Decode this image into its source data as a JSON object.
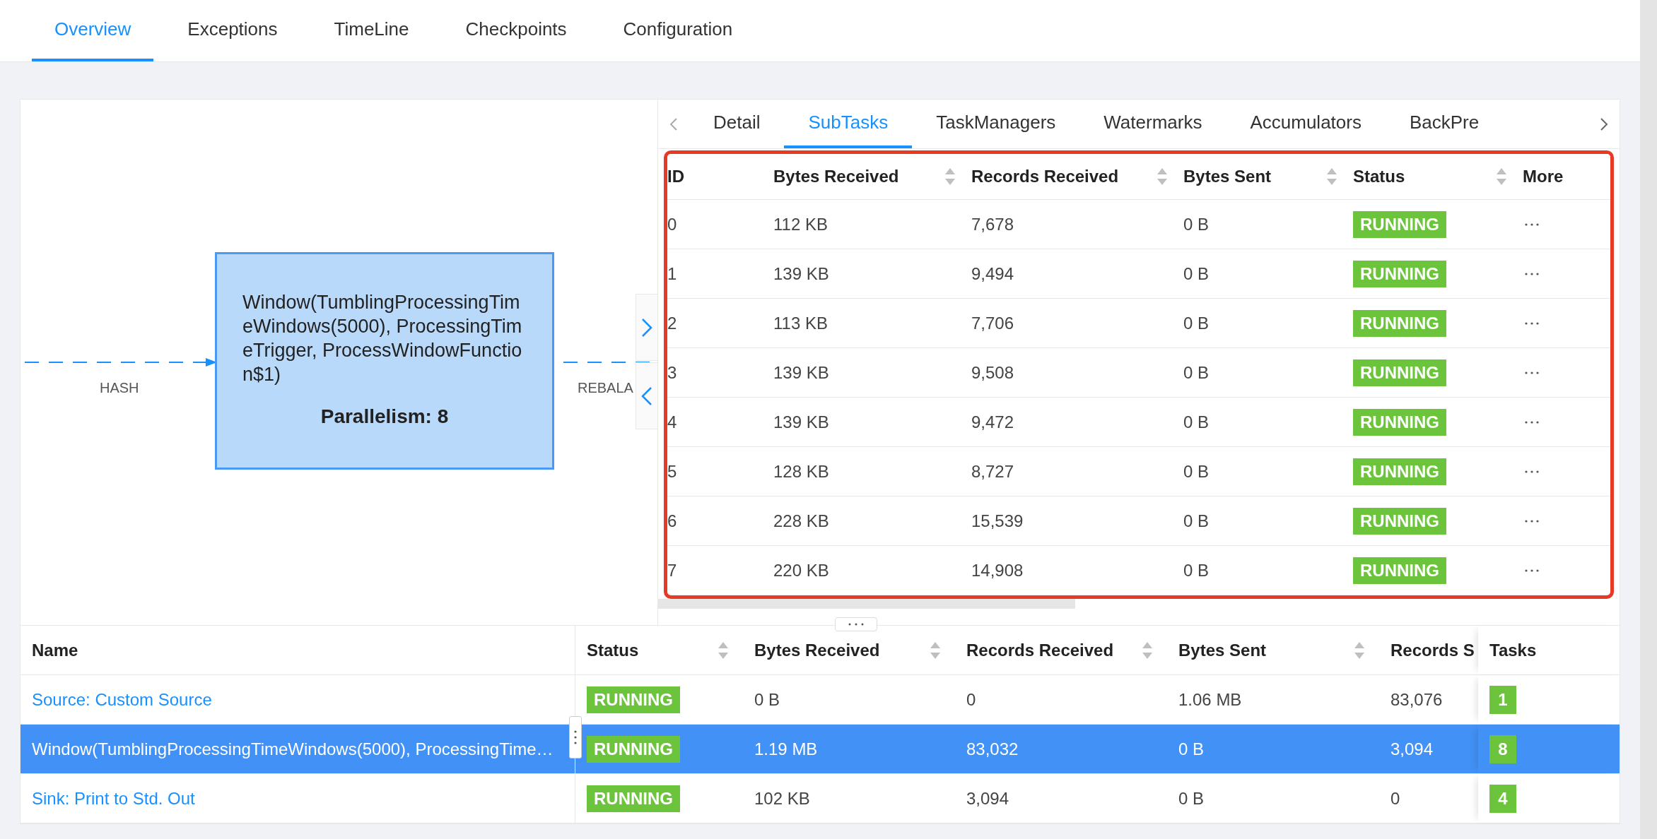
{
  "top_tabs": [
    {
      "label": "Overview",
      "selected": true
    },
    {
      "label": "Exceptions",
      "selected": false
    },
    {
      "label": "TimeLine",
      "selected": false
    },
    {
      "label": "Checkpoints",
      "selected": false
    },
    {
      "label": "Configuration",
      "selected": false
    }
  ],
  "graph": {
    "node": {
      "label": "Window(TumblingProcessingTimeWindows(5000), ProcessingTimeTrigger, ProcessWindowFunction$1)",
      "parallelism": "Parallelism: 8"
    },
    "edges": [
      {
        "label": "HASH"
      },
      {
        "label": "REBALA"
      }
    ]
  },
  "detail_tabs": [
    {
      "label": "Detail",
      "selected": false
    },
    {
      "label": "SubTasks",
      "selected": true
    },
    {
      "label": "TaskManagers",
      "selected": false
    },
    {
      "label": "Watermarks",
      "selected": false
    },
    {
      "label": "Accumulators",
      "selected": false
    },
    {
      "label": "BackPre",
      "selected": false
    }
  ],
  "subtasks": {
    "columns": [
      {
        "label": "ID",
        "sortable": false
      },
      {
        "label": "Bytes Received",
        "sortable": true
      },
      {
        "label": "Records Received",
        "sortable": true
      },
      {
        "label": "Bytes Sent",
        "sortable": true
      },
      {
        "label": "Status",
        "sortable": true
      },
      {
        "label": "More",
        "sortable": false
      }
    ],
    "rows": [
      {
        "id": "0",
        "bytes_received": "112 KB",
        "records_received": "7,678",
        "bytes_sent": "0 B",
        "status": "RUNNING"
      },
      {
        "id": "1",
        "bytes_received": "139 KB",
        "records_received": "9,494",
        "bytes_sent": "0 B",
        "status": "RUNNING"
      },
      {
        "id": "2",
        "bytes_received": "113 KB",
        "records_received": "7,706",
        "bytes_sent": "0 B",
        "status": "RUNNING"
      },
      {
        "id": "3",
        "bytes_received": "139 KB",
        "records_received": "9,508",
        "bytes_sent": "0 B",
        "status": "RUNNING"
      },
      {
        "id": "4",
        "bytes_received": "139 KB",
        "records_received": "9,472",
        "bytes_sent": "0 B",
        "status": "RUNNING"
      },
      {
        "id": "5",
        "bytes_received": "128 KB",
        "records_received": "8,727",
        "bytes_sent": "0 B",
        "status": "RUNNING"
      },
      {
        "id": "6",
        "bytes_received": "228 KB",
        "records_received": "15,539",
        "bytes_sent": "0 B",
        "status": "RUNNING"
      },
      {
        "id": "7",
        "bytes_received": "220 KB",
        "records_received": "14,908",
        "bytes_sent": "0 B",
        "status": "RUNNING"
      }
    ]
  },
  "vertices": {
    "columns": [
      {
        "label": "Name",
        "sortable": false
      },
      {
        "label": "Status",
        "sortable": true
      },
      {
        "label": "Bytes Received",
        "sortable": true
      },
      {
        "label": "Records Received",
        "sortable": true
      },
      {
        "label": "Bytes Sent",
        "sortable": true
      },
      {
        "label": "Records S",
        "sortable": false
      },
      {
        "label": "Tasks",
        "sortable": false
      }
    ],
    "rows": [
      {
        "name": "Source: Custom Source",
        "status": "RUNNING",
        "bytes_received": "0 B",
        "records_received": "0",
        "bytes_sent": "1.06 MB",
        "records_sent": "83,076",
        "tasks": "1",
        "selected": false
      },
      {
        "name": "Window(TumblingProcessingTimeWindows(5000), ProcessingTime…",
        "status": "RUNNING",
        "bytes_received": "1.19 MB",
        "records_received": "83,032",
        "bytes_sent": "0 B",
        "records_sent": "3,094",
        "tasks": "8",
        "selected": true
      },
      {
        "name": "Sink: Print to Std. Out",
        "status": "RUNNING",
        "bytes_received": "102 KB",
        "records_received": "3,094",
        "bytes_sent": "0 B",
        "records_sent": "0",
        "tasks": "4",
        "selected": false
      }
    ]
  }
}
